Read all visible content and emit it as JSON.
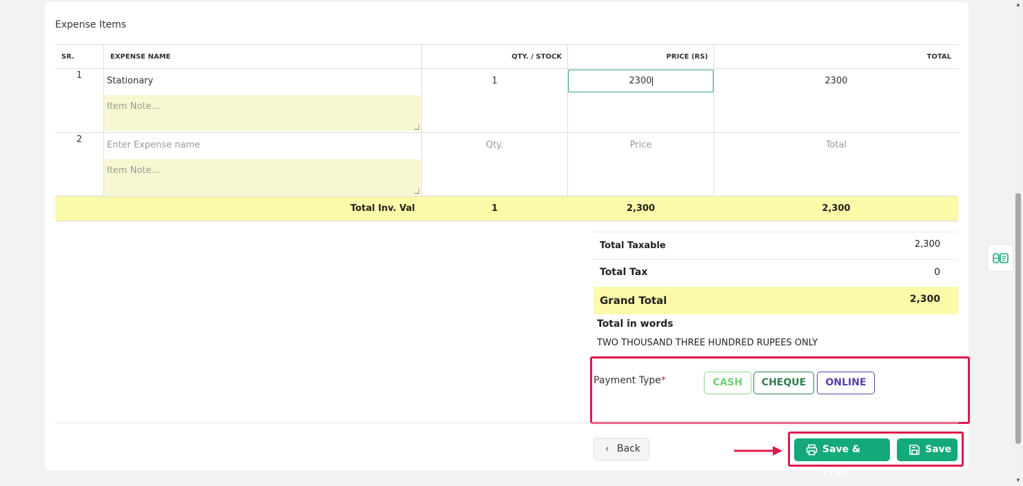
{
  "section": {
    "title": "Expense Items"
  },
  "table": {
    "headers": [
      "SR.",
      "EXPENSE NAME",
      "QTY. / STOCK",
      "PRICE (RS)",
      "TOTAL"
    ],
    "rows": [
      {
        "sr": "1",
        "name": "Stationary",
        "note_placeholder": "Item Note...",
        "qty": "1",
        "price": "2300",
        "total": "2300"
      },
      {
        "sr": "2",
        "name_placeholder": "Enter Expense name",
        "note_placeholder": "Item Note...",
        "qty_placeholder": "Qty.",
        "price_placeholder": "Price",
        "total_placeholder": "Total"
      }
    ],
    "totals": {
      "label": "Total Inv. Val",
      "qty": "1",
      "price": "2,300",
      "total": "2,300"
    }
  },
  "summary": {
    "taxable_label": "Total Taxable",
    "taxable_value": "2,300",
    "tax_label": "Total Tax",
    "tax_value": "0",
    "grand_label": "Grand Total",
    "grand_value": "2,300",
    "words_label": "Total in words",
    "words_value": "TWO THOUSAND THREE HUNDRED RUPEES ONLY"
  },
  "payment": {
    "label": "Payment Type",
    "required_mark": "*",
    "options": [
      "CASH",
      "CHEQUE",
      "ONLINE"
    ]
  },
  "actions": {
    "back": "Back",
    "save_print": "Save & Print",
    "save": "Save"
  },
  "colors": {
    "accent": "#13a97a",
    "highlight": "#fbfaa8",
    "annotation": "#e0174a",
    "online": "#5b3fa6",
    "cheque": "#2e7d4f",
    "cash": "#6fcf6f"
  },
  "icons": [
    "chevron-left-icon",
    "printer-icon",
    "save-icon",
    "arrow-right-icon",
    "side-tool-icon"
  ]
}
